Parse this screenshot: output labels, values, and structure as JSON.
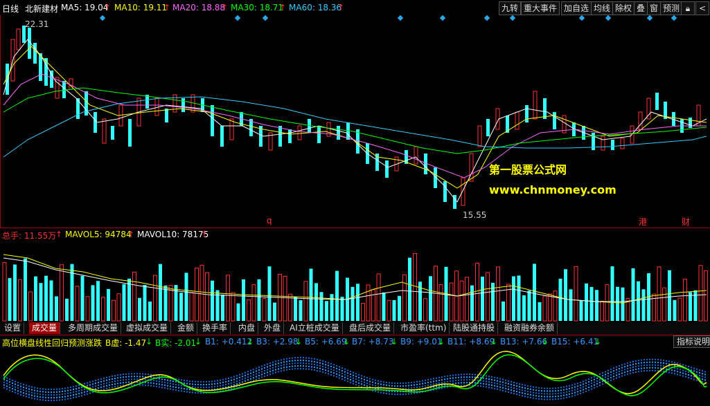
{
  "header": {
    "period": "日线",
    "stock_name": "北新建材",
    "ma": [
      {
        "label": "MA5: 19.04",
        "color": "#ffffff"
      },
      {
        "label": "MA10: 19.11",
        "color": "#ffff00"
      },
      {
        "label": "MA20: 18.88",
        "color": "#ff66ff"
      },
      {
        "label": "MA30: 18.71",
        "color": "#00ff00"
      },
      {
        "label": "MA60: 18.36",
        "color": "#33ccff"
      }
    ],
    "arrow": "↑"
  },
  "toolbar": [
    "九转",
    "重大事件",
    "加自选",
    "均线",
    "除权",
    "叠",
    "窗",
    "预测"
  ],
  "main_chart": {
    "high_label": "22.31",
    "low_label": "15.55",
    "markers": [
      {
        "label": "q",
        "color": "#ff3333"
      },
      {
        "label": "港",
        "color": "#ff3333"
      },
      {
        "label": "财",
        "color": "#ff3333"
      }
    ],
    "watermark_line1": "第一股票公式网",
    "watermark_line2": "www.chnmoney.com"
  },
  "volume": {
    "total_label": "总手: 11.55万",
    "arrow": "↑",
    "mavol5": "MAVOL5: 94784",
    "mavol10": "MAVOL10: 78175",
    "colors": {
      "up": "#ff3333",
      "down": "#33ffff"
    }
  },
  "tabs": [
    "设置",
    "成交量",
    "多周期成交量",
    "虚拟成交量",
    "金额",
    "换手率",
    "内盘",
    "外盘",
    "AI立桩成交量",
    "盘后成交量",
    "市盈率(ttm)",
    "陆股通持股",
    "融资融券余额"
  ],
  "indicator": {
    "name": "高位横盘线性回归预测涨跌",
    "values": [
      {
        "label": "B虚: -1.47",
        "arrow": "↓",
        "color": "#ffff00"
      },
      {
        "label": "B实: -2.01",
        "arrow": "↓",
        "color": "#00ff00"
      },
      {
        "label": "B1: +0.412",
        "arrow": "↓",
        "color": "#3399ff"
      },
      {
        "label": "B3: +2.98",
        "arrow": "↓",
        "color": "#3399ff"
      },
      {
        "label": "B5: +6.69",
        "arrow": "↓",
        "color": "#3399ff"
      },
      {
        "label": "B7: +8.73",
        "arrow": "↓",
        "color": "#3399ff"
      },
      {
        "label": "B9: +9.01",
        "arrow": "↓",
        "color": "#3399ff"
      },
      {
        "label": "B11: +8.69",
        "arrow": "↓",
        "color": "#3399ff"
      },
      {
        "label": "B13: +7.66",
        "arrow": "↓",
        "color": "#3399ff"
      },
      {
        "label": "B15: +6.41",
        "arrow": "↓",
        "color": "#3399ff"
      }
    ],
    "explain_button": "指标说明"
  }
}
